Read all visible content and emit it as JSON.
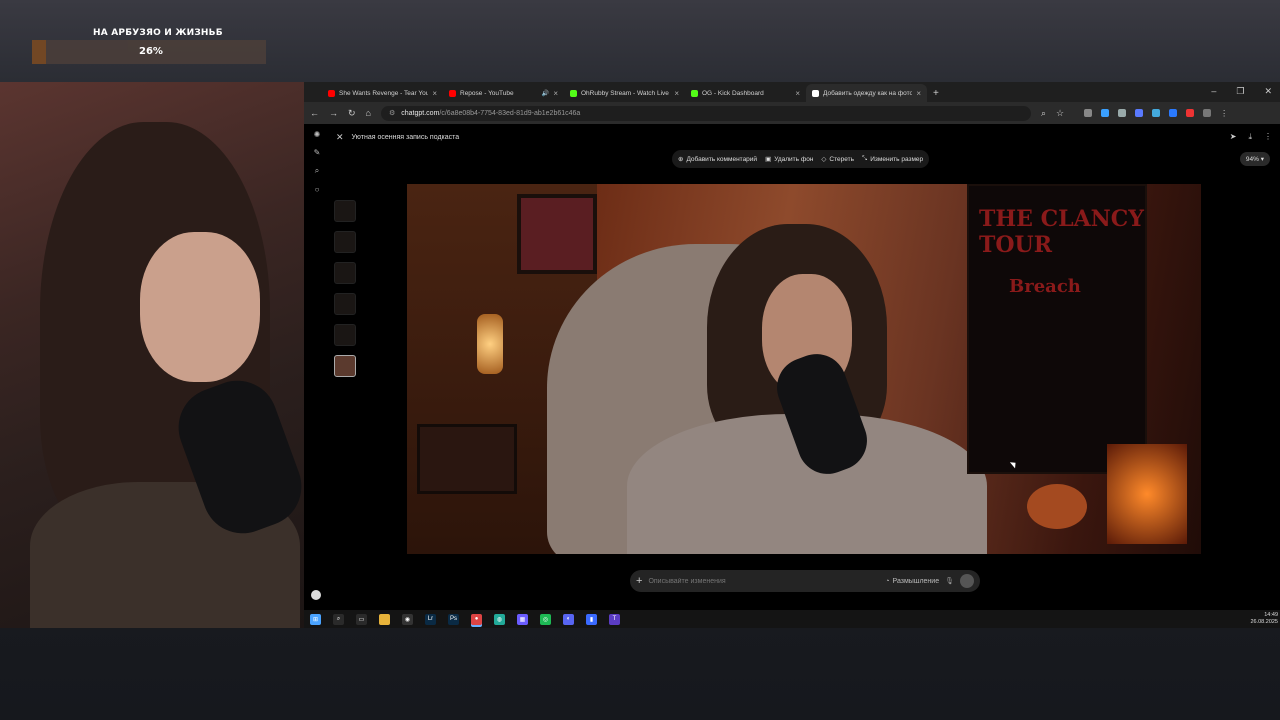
{
  "overlay": {
    "goal_title": "НА АРБУЗЯО И ЖИЗНЬБ",
    "goal_percent_label": "26%",
    "goal_progress": 0.26
  },
  "browser": {
    "tabs": [
      {
        "label": "She Wants Revenge - Tear You Apart",
        "icon": "youtube-icon",
        "color": "#ff0000"
      },
      {
        "label": "Repose - YouTube",
        "icon": "youtube-icon",
        "color": "#ff0000",
        "audio": true
      },
      {
        "label": "OhRubby Stream - Watch Live",
        "icon": "kick-icon",
        "color": "#53fc18"
      },
      {
        "label": "OG - Kick Dashboard",
        "icon": "kick-icon",
        "color": "#53fc18"
      },
      {
        "label": "Добавить одежду как на фото",
        "icon": "chatgpt-icon",
        "color": "#ffffff",
        "active": true
      }
    ],
    "url_host": "chatgpt.com",
    "url_path": "/c/6a8e08b4-7754-83ed-81d9-ab1e2b61c46a"
  },
  "app": {
    "conversation_title": "Уютная осенняя запись подкаста",
    "toolbar": {
      "add_comment": "Добавить комментарий",
      "remove_bg": "Удалить фон",
      "erase": "Стереть",
      "resize": "Изменить размер"
    },
    "zoom": "94%",
    "poster_text_1": "THE CLANCY TOUR",
    "poster_text_2": "Breach",
    "composer_placeholder": "Описывайте изменения",
    "think_label": "Размышление"
  },
  "taskbar": {
    "time": "14:49",
    "date": "26.08.2025",
    "apps": [
      {
        "name": "start-icon",
        "color": "#4aa3ff",
        "glyph": "⊞"
      },
      {
        "name": "search-icon",
        "color": "#2a2a2a",
        "glyph": "⌕"
      },
      {
        "name": "task-view-icon",
        "color": "#2a2a2a",
        "glyph": "▭"
      },
      {
        "name": "file-explorer-icon",
        "color": "#e8b33a",
        "glyph": ""
      },
      {
        "name": "obs-icon",
        "color": "#333",
        "glyph": "◉"
      },
      {
        "name": "lightroom-icon",
        "color": "#0a2a44",
        "glyph": "Lr"
      },
      {
        "name": "photoshop-icon",
        "color": "#0a2a44",
        "glyph": "Ps"
      },
      {
        "name": "chrome-icon",
        "color": "#d44",
        "glyph": "●",
        "active": true
      },
      {
        "name": "chatgpt-app-icon",
        "color": "#2a9",
        "glyph": "◍"
      },
      {
        "name": "calculator-icon",
        "color": "#6a5cff",
        "glyph": "▦"
      },
      {
        "name": "spotify-icon",
        "color": "#1db954",
        "glyph": "◎"
      },
      {
        "name": "discord-icon",
        "color": "#5865f2",
        "glyph": "◐"
      },
      {
        "name": "stats-icon",
        "color": "#3a6aff",
        "glyph": "▮"
      },
      {
        "name": "t-app-icon",
        "color": "#5b3cc4",
        "glyph": "T"
      }
    ]
  }
}
